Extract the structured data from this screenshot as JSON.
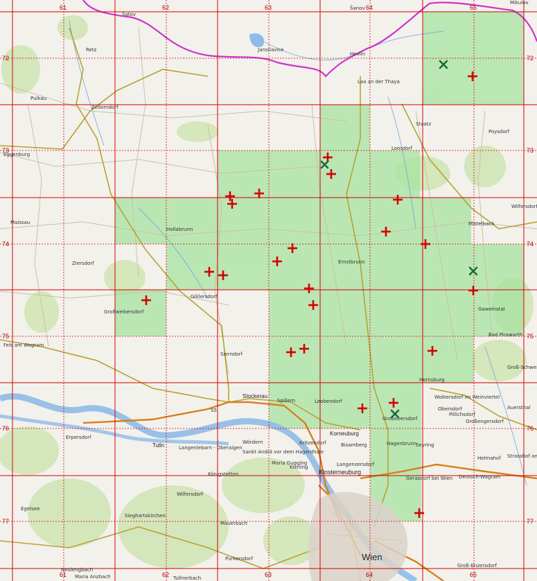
{
  "map": {
    "colors": {
      "land": "#f3f1ec",
      "green_cell": "#a7e3a0",
      "grid": "#d40000",
      "border_country": "#cc33cc",
      "road_main": "#b7a232",
      "road_major": "#d77f1c",
      "river": "#6fa4dc",
      "marker_plus": "#d50000",
      "marker_x": "#1a6b3a"
    },
    "grid_cols": [
      "61",
      "62",
      "63",
      "64",
      "65"
    ],
    "grid_rows": [
      "72",
      "73",
      "74",
      "75",
      "76",
      "77"
    ],
    "grid_bottom_cols": [
      "61",
      "62",
      "63",
      "64",
      "65"
    ],
    "places": [
      {
        "id": "satov",
        "label": "Šatov"
      },
      {
        "id": "sanov",
        "label": "Šanov"
      },
      {
        "id": "mikulov",
        "label": "Mikulov"
      },
      {
        "id": "retz",
        "label": "Retz"
      },
      {
        "id": "jaroslavice",
        "label": "Jaroslavice"
      },
      {
        "id": "hevlin",
        "label": "Hevlín"
      },
      {
        "id": "laa",
        "label": "Laa an der Thaya"
      },
      {
        "id": "pulkau",
        "label": "Pulkau"
      },
      {
        "id": "zellerndorf",
        "label": "Zellerndorf"
      },
      {
        "id": "staatz",
        "label": "Staatz"
      },
      {
        "id": "poysdorf",
        "label": "Poysdorf"
      },
      {
        "id": "eggenburg",
        "label": "Eggenburg"
      },
      {
        "id": "loosdorf",
        "label": "Loosdorf"
      },
      {
        "id": "wilfersdorf",
        "label": "Wilfersdorf"
      },
      {
        "id": "maissau",
        "label": "Maissau"
      },
      {
        "id": "hollabrunn",
        "label": "Hollabrunn"
      },
      {
        "id": "mistelbach",
        "label": "Mistelbach"
      },
      {
        "id": "ziersdorf",
        "label": "Ziersdorf"
      },
      {
        "id": "ernstbrunn",
        "label": "Ernstbrunn"
      },
      {
        "id": "gollersdorf",
        "label": "Göllersdorf"
      },
      {
        "id": "grossweikersdorf",
        "label": "Großweikersdorf"
      },
      {
        "id": "gaweinstal",
        "label": "Gaweinstal"
      },
      {
        "id": "fels",
        "label": "Fels am Wagram"
      },
      {
        "id": "badpirawarth",
        "label": "Bad Pirawarth"
      },
      {
        "id": "sierndorf",
        "label": "Sierndorf"
      },
      {
        "id": "grossschweinbarth",
        "label": "Groß-Schweinbarth"
      },
      {
        "id": "harmannsdorf",
        "label": "Hornsburg"
      },
      {
        "id": "wolkersdorf",
        "label": "Wolkersdorf im Weinviertel"
      },
      {
        "id": "obersdorf",
        "label": "Obersdorf"
      },
      {
        "id": "pillichsdorf",
        "label": "Pillichsdorf"
      },
      {
        "id": "grossengersdorf",
        "label": "Großengersdorf"
      },
      {
        "id": "auersthal",
        "label": "Auersthal"
      },
      {
        "id": "stockerau",
        "label": "Stockerau"
      },
      {
        "id": "spillern",
        "label": "Spillern"
      },
      {
        "id": "leobendorf",
        "label": "Leobendorf"
      },
      {
        "id": "grossebersdorf",
        "label": "Großebersdorf"
      },
      {
        "id": "erpersdorf",
        "label": "Erpersdorf"
      },
      {
        "id": "tulln",
        "label": "Tulln"
      },
      {
        "id": "langenlebarn",
        "label": "Langenlebarn - Oberaigen"
      },
      {
        "id": "wordern",
        "label": "Wördern"
      },
      {
        "id": "korneuburg",
        "label": "Korneuburg"
      },
      {
        "id": "bisamberg",
        "label": "Bisamberg"
      },
      {
        "id": "hagenbrunn",
        "label": "Hagenbrunn"
      },
      {
        "id": "seyring",
        "label": "Seyring"
      },
      {
        "id": "kritzendorf",
        "label": "Kritzendorf"
      },
      {
        "id": "andra",
        "label": "Sankt Andrä vor dem Hagenthale"
      },
      {
        "id": "gugging",
        "label": "Maria Gugging"
      },
      {
        "id": "kierling",
        "label": "Kierling"
      },
      {
        "id": "langenzersdorf",
        "label": "Langenzersdorf"
      },
      {
        "id": "helmahof",
        "label": "Helmahof"
      },
      {
        "id": "strasshof",
        "label": "Strasshof an der"
      },
      {
        "id": "gerasdorf",
        "label": "Gerasdorf bei Wien"
      },
      {
        "id": "deutschwagram",
        "label": "Deutsch-Wagram"
      },
      {
        "id": "klosterneuburg",
        "label": "Klosterneuburg"
      },
      {
        "id": "konigstetten",
        "label": "Königstetten"
      },
      {
        "id": "egelsee",
        "label": "Egelsee"
      },
      {
        "id": "wilfersdorf2",
        "label": "Wilfersdorf"
      },
      {
        "id": "sieghartskirchen",
        "label": "Sieghartskirchen"
      },
      {
        "id": "mauerbach",
        "label": "Mauerbach"
      },
      {
        "id": "wien",
        "label": "Wien"
      },
      {
        "id": "grossenzersdorf",
        "label": "Groß-Enzersdorf"
      },
      {
        "id": "purkersdorf",
        "label": "Purkersdorf"
      },
      {
        "id": "anzbach",
        "label": "Maria Anzbach"
      },
      {
        "id": "neulengbach",
        "label": "Neulengbach"
      },
      {
        "id": "tullnerbach",
        "label": "Tullnerbach"
      },
      {
        "id": "route55",
        "label": "S5"
      }
    ]
  }
}
